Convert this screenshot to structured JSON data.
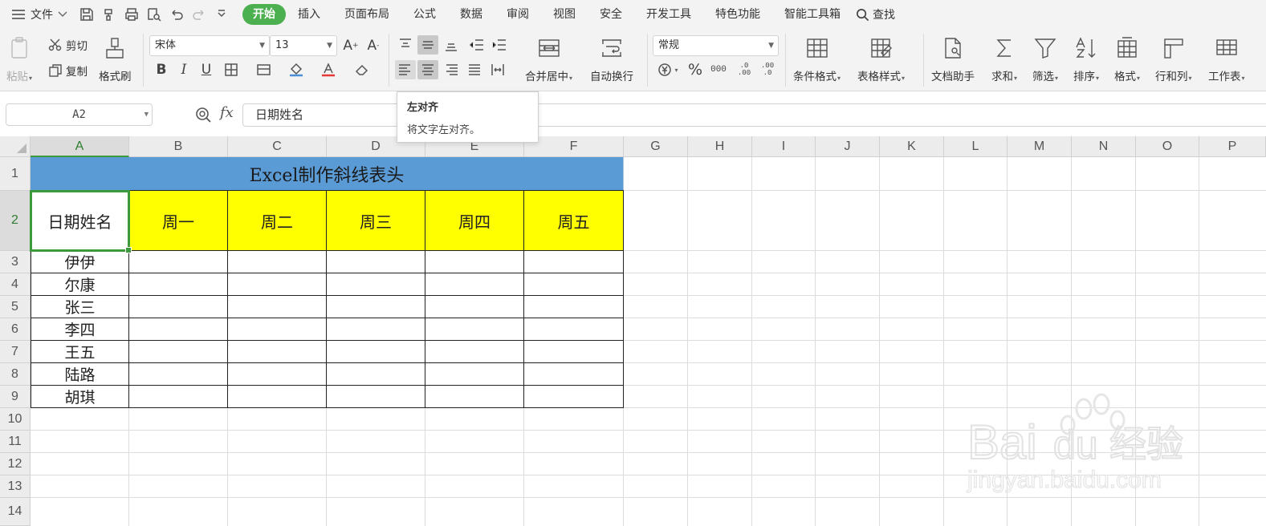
{
  "menubar": {
    "file_label": "文件",
    "tabs": [
      "开始",
      "插入",
      "页面布局",
      "公式",
      "数据",
      "审阅",
      "视图",
      "安全",
      "开发工具",
      "特色功能",
      "智能工具箱"
    ],
    "active_tab": "开始",
    "search_label": "查找"
  },
  "ribbon": {
    "paste": "粘贴",
    "cut": "剪切",
    "copy": "复制",
    "format_painter": "格式刷",
    "font_name": "宋体",
    "font_size": "13",
    "bold": "B",
    "italic": "I",
    "underline": "U",
    "merge_center": "合并居中",
    "wrap_text": "自动换行",
    "number_format": "常规",
    "percent": "%",
    "thousands": "000",
    "inc_decimal": ".0 .00",
    "dec_decimal": ".00 .0",
    "conditional_format": "条件格式",
    "table_style": "表格样式",
    "doc_assistant": "文档助手",
    "sum": "求和",
    "filter": "筛选",
    "sort": "排序",
    "format": "格式",
    "row_col": "行和列",
    "worksheet": "工作表"
  },
  "tooltip": {
    "title": "左对齐",
    "description": "将文字左对齐。"
  },
  "formula_bar": {
    "name_box": "A2",
    "fx": "fx",
    "content": "日期姓名"
  },
  "sheet": {
    "columns": [
      "A",
      "B",
      "C",
      "D",
      "E",
      "F",
      "G",
      "H",
      "I",
      "J",
      "K",
      "L",
      "M",
      "N",
      "O",
      "P"
    ],
    "rows": [
      "1",
      "2",
      "3",
      "4",
      "5",
      "6",
      "7",
      "8",
      "9",
      "10",
      "11",
      "12",
      "13",
      "14"
    ],
    "selected_column": "A",
    "selected_row": "2",
    "title": "Excel制作斜线表头",
    "header": [
      "日期姓名",
      "周一",
      "周二",
      "周三",
      "周四",
      "周五"
    ],
    "names": [
      "伊伊",
      "尔康",
      "张三",
      "李四",
      "王五",
      "陆路",
      "胡琪"
    ]
  },
  "colors": {
    "accent": "#4caf50",
    "title_fill": "#5b9bd5",
    "header_fill": "#ffff00",
    "selection": "#3c9a3c"
  },
  "watermark": {
    "brand": "Bai",
    "brand2": "du",
    "cn": "经验",
    "url": "jingyan.baidu.com"
  }
}
